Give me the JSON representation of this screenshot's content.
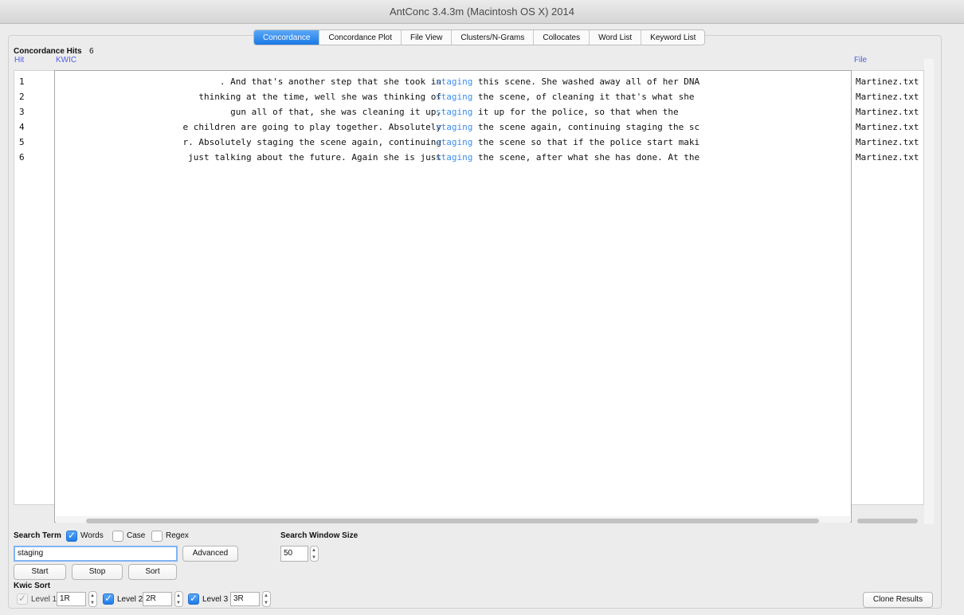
{
  "window": {
    "title": "AntConc 3.4.3m (Macintosh OS X) 2014"
  },
  "tabs": [
    {
      "label": "Concordance",
      "active": true
    },
    {
      "label": "Concordance Plot",
      "active": false
    },
    {
      "label": "File View",
      "active": false
    },
    {
      "label": "Clusters/N-Grams",
      "active": false
    },
    {
      "label": "Collocates",
      "active": false
    },
    {
      "label": "Word List",
      "active": false
    },
    {
      "label": "Keyword List",
      "active": false
    }
  ],
  "hits": {
    "label": "Concordance Hits",
    "count": "6"
  },
  "columns": {
    "hit": "Hit",
    "kwic": "KWIC",
    "file": "File"
  },
  "keyword_color": "#3b8ef0",
  "rows": [
    {
      "hit": "1",
      "left": ". And that's another step that she took in",
      "keyword": "staging",
      "right": "this scene. She washed away all of her DNA",
      "file": "Martinez.txt"
    },
    {
      "hit": "2",
      "left": "thinking at the time, well she was thinking of",
      "keyword": "staging",
      "right": "the scene, of cleaning it that's what she",
      "file": "Martinez.txt"
    },
    {
      "hit": "3",
      "left": "gun all of that, she was cleaning it up,",
      "keyword": "staging",
      "right": "it up for the police, so that when the",
      "file": "Martinez.txt"
    },
    {
      "hit": "4",
      "left": "e children are going to play together. Absolutely",
      "keyword": "staging",
      "right": "the scene again, continuing staging the sc",
      "file": "Martinez.txt"
    },
    {
      "hit": "5",
      "left": "r. Absolutely staging the scene again, continuing",
      "keyword": "staging",
      "right": "the scene so that if the police start maki",
      "file": "Martinez.txt"
    },
    {
      "hit": "6",
      "left": "just talking about the future. Again she is just",
      "keyword": "staging",
      "right": "the scene, after what she has done. At the",
      "file": "Martinez.txt"
    }
  ],
  "search": {
    "term_label": "Search Term",
    "words_label": "Words",
    "words_checked": true,
    "case_label": "Case",
    "case_checked": false,
    "regex_label": "Regex",
    "regex_checked": false,
    "value": "staging",
    "advanced_label": "Advanced",
    "window_size_label": "Search Window Size",
    "window_size_value": "50"
  },
  "buttons": {
    "start": "Start",
    "stop": "Stop",
    "sort": "Sort",
    "clone": "Clone Results"
  },
  "kwic_sort": {
    "label": "Kwic Sort",
    "levels": [
      {
        "label": "Level 1",
        "value": "1R",
        "checked": true,
        "disabled": true
      },
      {
        "label": "Level 2",
        "value": "2R",
        "checked": true,
        "disabled": false
      },
      {
        "label": "Level 3",
        "value": "3R",
        "checked": true,
        "disabled": false
      }
    ]
  }
}
